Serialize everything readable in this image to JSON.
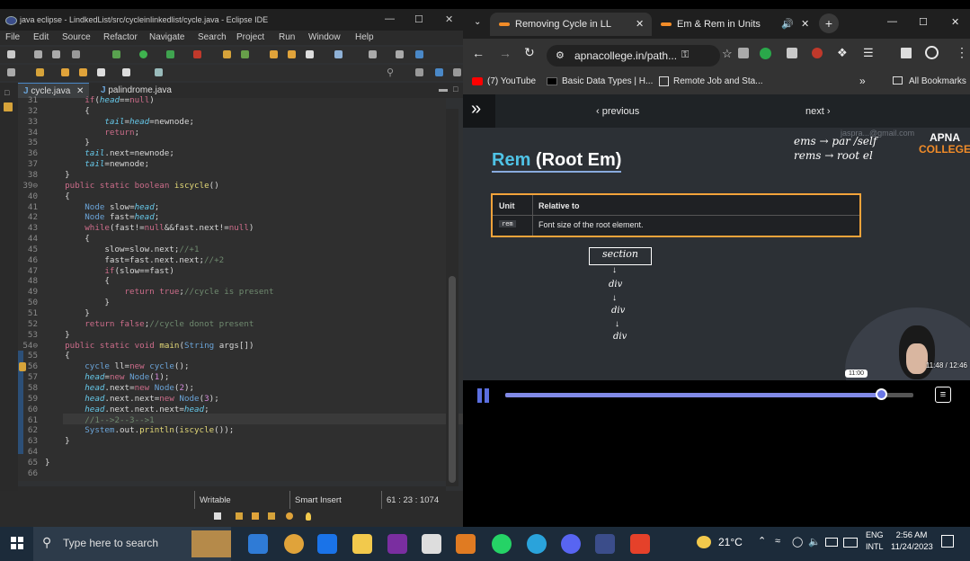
{
  "eclipse": {
    "title": "java eclipse - LindkedList/src/cycleinlinkedlist/cycle.java - Eclipse IDE",
    "menu": [
      "File",
      "Edit",
      "Source",
      "Refactor",
      "Navigate",
      "Search",
      "Project",
      "Run",
      "Window",
      "Help"
    ],
    "tabs": [
      {
        "label": "cycle.java",
        "active": true
      },
      {
        "label": "palindrome.java",
        "active": false
      }
    ],
    "lines": [
      {
        "n": "31",
        "text": "        if(head==null)"
      },
      {
        "n": "32",
        "text": "        {"
      },
      {
        "n": "33",
        "text": "            tail=head=newnode;"
      },
      {
        "n": "34",
        "text": "            return;"
      },
      {
        "n": "35",
        "text": "        }"
      },
      {
        "n": "36",
        "text": "        tail.next=newnode;"
      },
      {
        "n": "37",
        "text": "        tail=newnode;"
      },
      {
        "n": "38",
        "text": "    }"
      },
      {
        "n": "39⊖",
        "text": "    public static boolean iscycle()"
      },
      {
        "n": "40",
        "text": "    {"
      },
      {
        "n": "41",
        "text": "        Node slow=head;"
      },
      {
        "n": "42",
        "text": "        Node fast=head;"
      },
      {
        "n": "43",
        "text": "        while(fast!=null&&fast.next!=null)"
      },
      {
        "n": "44",
        "text": "        {"
      },
      {
        "n": "45",
        "text": "            slow=slow.next;//+1"
      },
      {
        "n": "46",
        "text": "            fast=fast.next.next;//+2"
      },
      {
        "n": "47",
        "text": "            if(slow==fast)"
      },
      {
        "n": "48",
        "text": "            {"
      },
      {
        "n": "49",
        "text": "                return true;//cycle is present"
      },
      {
        "n": "50",
        "text": "            }"
      },
      {
        "n": "51",
        "text": "        }"
      },
      {
        "n": "52",
        "text": "        return false;//cycle donot present"
      },
      {
        "n": "53",
        "text": "    }"
      },
      {
        "n": "54⊖",
        "text": "    public static void main(String args[])"
      },
      {
        "n": "55",
        "text": "    {"
      },
      {
        "n": "56",
        "text": "        cycle ll=new cycle();"
      },
      {
        "n": "57",
        "text": "        head=new Node(1);"
      },
      {
        "n": "58",
        "text": "        head.next=new Node(2);"
      },
      {
        "n": "59",
        "text": "        head.next.next=new Node(3);"
      },
      {
        "n": "60",
        "text": "        head.next.next.next=head;"
      },
      {
        "n": "61",
        "text": "        //1-->2--3-->1"
      },
      {
        "n": "62",
        "text": "        System.out.println(iscycle());"
      },
      {
        "n": "63",
        "text": "    }"
      },
      {
        "n": "64",
        "text": ""
      },
      {
        "n": "65",
        "text": "}"
      },
      {
        "n": "66",
        "text": ""
      }
    ],
    "status": {
      "mode": "Writable",
      "insert": "Smart Insert",
      "position": "61 : 23 : 1074"
    }
  },
  "chrome": {
    "tabs": [
      {
        "label": "Removing Cycle in LL",
        "active": true
      },
      {
        "label": "Em & Rem in Units",
        "active": false
      }
    ],
    "url": "apnacollege.in/path...",
    "bookmarks": [
      "(7) YouTube",
      "Basic Data Types | H...",
      "Remote Job and Sta...",
      "All Bookmarks"
    ],
    "nav": {
      "previous": "‹ previous",
      "next": "next ›"
    },
    "slide": {
      "title_main": "Rem",
      "title_rest": " (Root Em)",
      "brand_line1": "APNA",
      "brand_line2": "COLLEGE",
      "watermark": "jaspra...@gmail.com",
      "note_line1": "ems →  par /self",
      "note_line2": "rems → root el",
      "table_headers": [
        "Unit",
        "Relative to"
      ],
      "table_row": {
        "unit": "rem",
        "desc": "Font size of the root element."
      },
      "diagram": [
        "section",
        "div",
        "div",
        "div"
      ]
    },
    "player": {
      "time": "11:48 / 12:46",
      "tooltip": "11:00",
      "progress": 0.922
    }
  },
  "taskbar": {
    "search_placeholder": "Type here to search",
    "weather": "21°C",
    "lang_line1": "ENG",
    "lang_line2": "INTL",
    "time": "2:56 AM",
    "date": "11/24/2023"
  }
}
